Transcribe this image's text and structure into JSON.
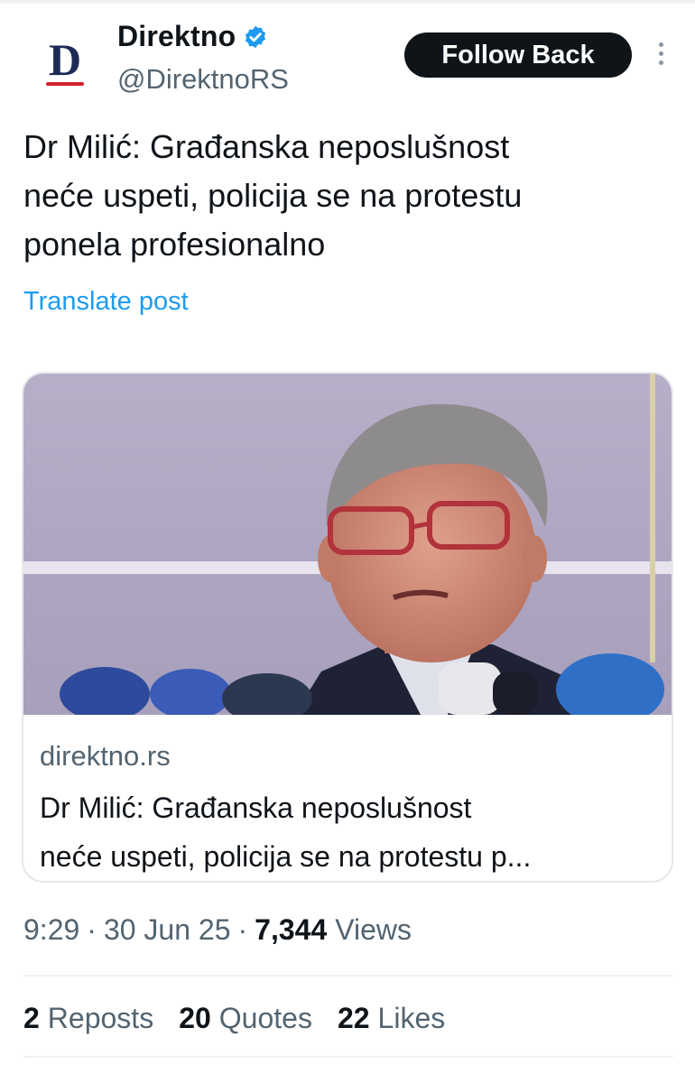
{
  "account": {
    "display_name": "Direktno",
    "handle": "@DirektnoRS",
    "avatar_letter": "D",
    "verified_icon": "verified-badge-icon",
    "verified_color": "#1d9bf0"
  },
  "follow_button": {
    "label": "Follow Back"
  },
  "more_icon": "more-vertical-icon",
  "post": {
    "text": "Dr Milić: Građanska neposlušnost\nneće uspeti, policija se na protestu\nponela profesionalno",
    "translate_label": "Translate post"
  },
  "link_card": {
    "domain": "direktno.rs",
    "title": "Dr Milić: Građanska neposlušnost\nneće uspeti, policija se na protestu p..."
  },
  "meta": {
    "time": "9:29",
    "sep1": "·",
    "date": "30 Jun 25",
    "sep2": "·",
    "views_count": "7,344",
    "views_label": "Views"
  },
  "stats": {
    "reposts_count": "2",
    "reposts_label": "Reposts",
    "quotes_count": "20",
    "quotes_label": "Quotes",
    "likes_count": "22",
    "likes_label": "Likes"
  },
  "colors": {
    "accent": "#1d9bf0",
    "text_primary": "#0f1419",
    "text_secondary": "#536471",
    "button_bg": "#0f1419",
    "logo_navy": "#1c2a57",
    "logo_red": "#d2222d"
  }
}
